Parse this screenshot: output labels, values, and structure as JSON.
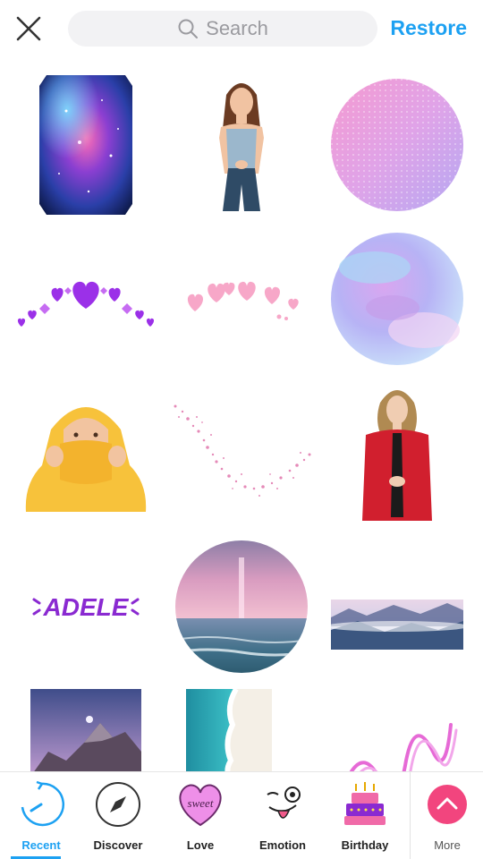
{
  "header": {
    "close_icon": "close-icon",
    "search_placeholder": "Search",
    "restore_label": "Restore"
  },
  "stickers": [
    {
      "name": "galaxy-sticker",
      "kind": "galaxy"
    },
    {
      "name": "girl-sticker",
      "kind": "person"
    },
    {
      "name": "pink-glitter-circle-sticker",
      "kind": "glitter"
    },
    {
      "name": "purple-hearts-crown-sticker",
      "kind": "purple-hearts"
    },
    {
      "name": "pink-hearts-crown-sticker",
      "kind": "pink-hearts"
    },
    {
      "name": "pastel-cloud-circle-sticker",
      "kind": "pastel"
    },
    {
      "name": "yellow-hoodie-sticker",
      "kind": "hoodie"
    },
    {
      "name": "pink-sparkles-sticker",
      "kind": "sparkles"
    },
    {
      "name": "adele-sticker",
      "kind": "adele"
    },
    {
      "name": "adele-text-sticker",
      "kind": "text",
      "text": "ADELE"
    },
    {
      "name": "pink-ocean-sunset-sticker",
      "kind": "ocean"
    },
    {
      "name": "misty-mountains-sticker",
      "kind": "mountains"
    },
    {
      "name": "moon-mountain-sticker",
      "kind": "moon"
    },
    {
      "name": "ocean-wave-sticker",
      "kind": "wave"
    },
    {
      "name": "pink-swirl-sticker",
      "kind": "swirl"
    }
  ],
  "tabs": [
    {
      "label": "Recent",
      "icon": "recent-icon",
      "active": true
    },
    {
      "label": "Discover",
      "icon": "compass-icon",
      "active": false
    },
    {
      "label": "Love",
      "icon": "sweet-heart-icon",
      "active": false
    },
    {
      "label": "Emotion",
      "icon": "emotion-face-icon",
      "active": false
    },
    {
      "label": "Birthday",
      "icon": "birthday-cake-icon",
      "active": false
    },
    {
      "label": "More",
      "icon": "chevron-up-icon",
      "active": false
    }
  ],
  "colors": {
    "accent": "#1da1f2",
    "more_button": "#f2457e"
  }
}
